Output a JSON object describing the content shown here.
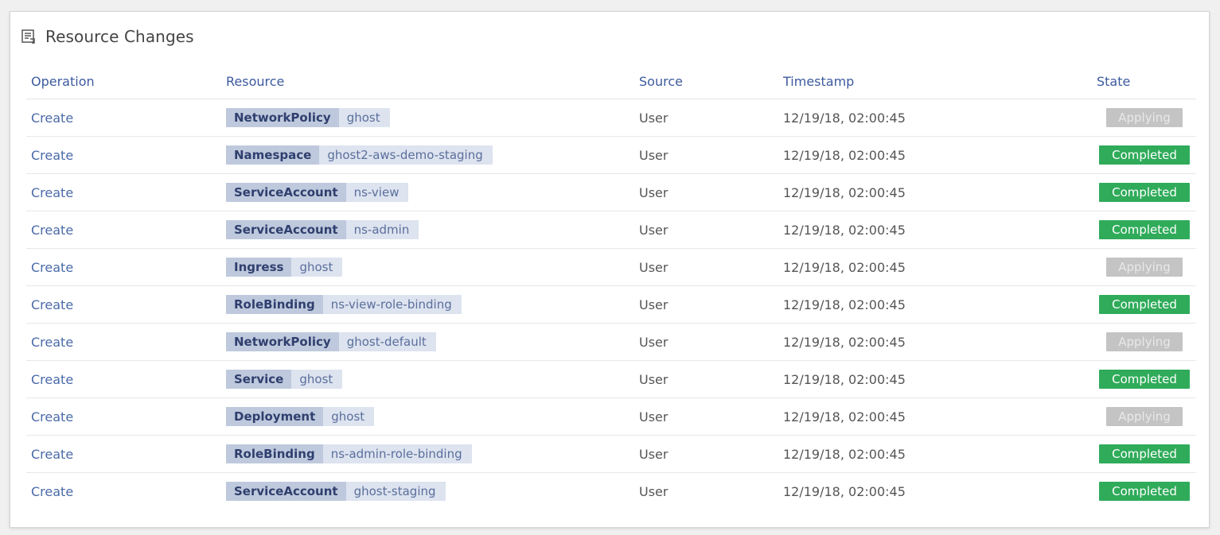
{
  "panel": {
    "title": "Resource Changes",
    "icon": "document-list-icon"
  },
  "table": {
    "columns": [
      "Operation",
      "Resource",
      "Source",
      "Timestamp",
      "State"
    ],
    "rows": [
      {
        "operation": "Create",
        "kind": "NetworkPolicy",
        "name": "ghost",
        "source": "User",
        "timestamp": "12/19/18, 02:00:45",
        "state": "Applying"
      },
      {
        "operation": "Create",
        "kind": "Namespace",
        "name": "ghost2-aws-demo-staging",
        "source": "User",
        "timestamp": "12/19/18, 02:00:45",
        "state": "Completed"
      },
      {
        "operation": "Create",
        "kind": "ServiceAccount",
        "name": "ns-view",
        "source": "User",
        "timestamp": "12/19/18, 02:00:45",
        "state": "Completed"
      },
      {
        "operation": "Create",
        "kind": "ServiceAccount",
        "name": "ns-admin",
        "source": "User",
        "timestamp": "12/19/18, 02:00:45",
        "state": "Completed"
      },
      {
        "operation": "Create",
        "kind": "Ingress",
        "name": "ghost",
        "source": "User",
        "timestamp": "12/19/18, 02:00:45",
        "state": "Applying"
      },
      {
        "operation": "Create",
        "kind": "RoleBinding",
        "name": "ns-view-role-binding",
        "source": "User",
        "timestamp": "12/19/18, 02:00:45",
        "state": "Completed"
      },
      {
        "operation": "Create",
        "kind": "NetworkPolicy",
        "name": "ghost-default",
        "source": "User",
        "timestamp": "12/19/18, 02:00:45",
        "state": "Applying"
      },
      {
        "operation": "Create",
        "kind": "Service",
        "name": "ghost",
        "source": "User",
        "timestamp": "12/19/18, 02:00:45",
        "state": "Completed"
      },
      {
        "operation": "Create",
        "kind": "Deployment",
        "name": "ghost",
        "source": "User",
        "timestamp": "12/19/18, 02:00:45",
        "state": "Applying"
      },
      {
        "operation": "Create",
        "kind": "RoleBinding",
        "name": "ns-admin-role-binding",
        "source": "User",
        "timestamp": "12/19/18, 02:00:45",
        "state": "Completed"
      },
      {
        "operation": "Create",
        "kind": "ServiceAccount",
        "name": "ghost-staging",
        "source": "User",
        "timestamp": "12/19/18, 02:00:45",
        "state": "Completed"
      }
    ]
  },
  "colors": {
    "header_text": "#3c5a9e",
    "completed": "#2fab5a",
    "applying": "#c4c4c4"
  }
}
